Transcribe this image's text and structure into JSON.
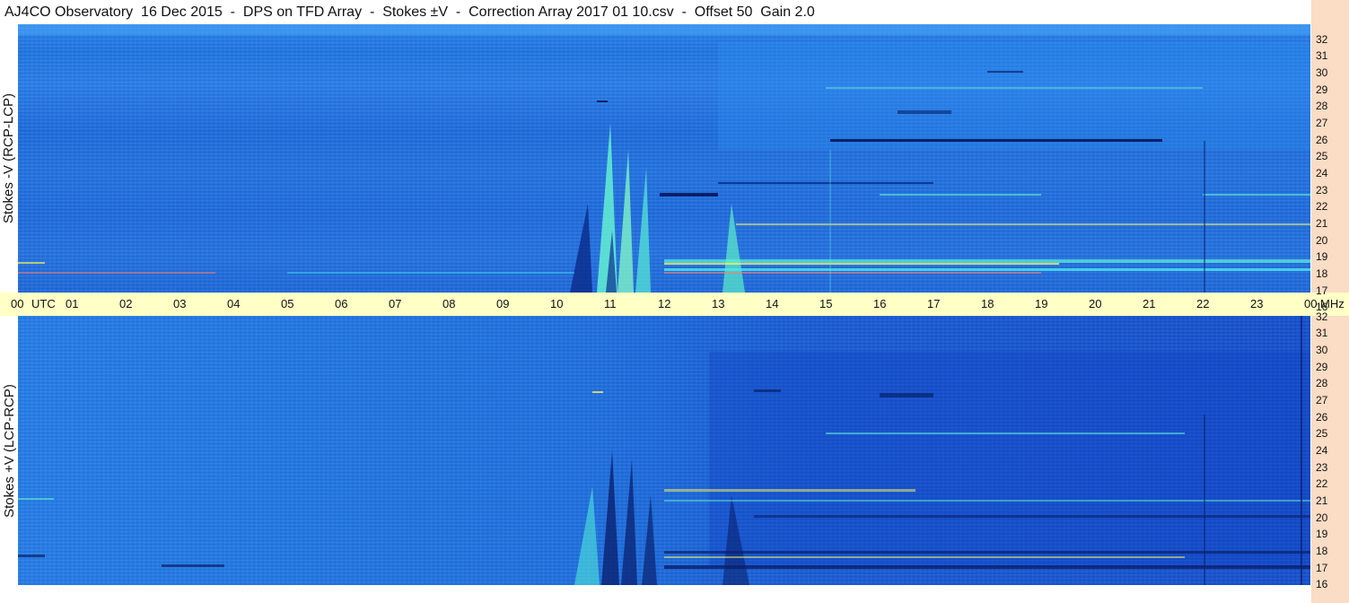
{
  "title": "AJ4CO Observatory  16 Dec 2015  -  DPS on TFD Array  -  Stokes ±V  -  Correction Array 2017 01 10.csv  -  Offset 50  Gain 2.0",
  "panels": [
    {
      "label": "Stokes -V (RCP-LCP)",
      "base_color": "#1f6fe0"
    },
    {
      "label": "Stokes +V (LCP-RCP)",
      "base_color": "#1c58d6"
    }
  ],
  "time_axis": {
    "unit": "UTC",
    "ticks": [
      "00",
      "01",
      "02",
      "03",
      "04",
      "05",
      "06",
      "07",
      "08",
      "09",
      "10",
      "11",
      "12",
      "13",
      "14",
      "15",
      "16",
      "17",
      "18",
      "19",
      "20",
      "21",
      "22",
      "23",
      "00"
    ]
  },
  "freq_axis": {
    "unit": "MHz",
    "ticks": [
      "32",
      "31",
      "30",
      "29",
      "28",
      "27",
      "26",
      "25",
      "24",
      "23",
      "22",
      "21",
      "20",
      "19",
      "18",
      "17",
      "16"
    ]
  },
  "colors": {
    "background_low": "#0e3fbf",
    "background_mid": "#1f6fe0",
    "emission_high": "#5ff0d8",
    "emission_peak": "#f0f060",
    "axis_bg": "#ffffc6",
    "side_strip": "#fbdcc4"
  }
}
